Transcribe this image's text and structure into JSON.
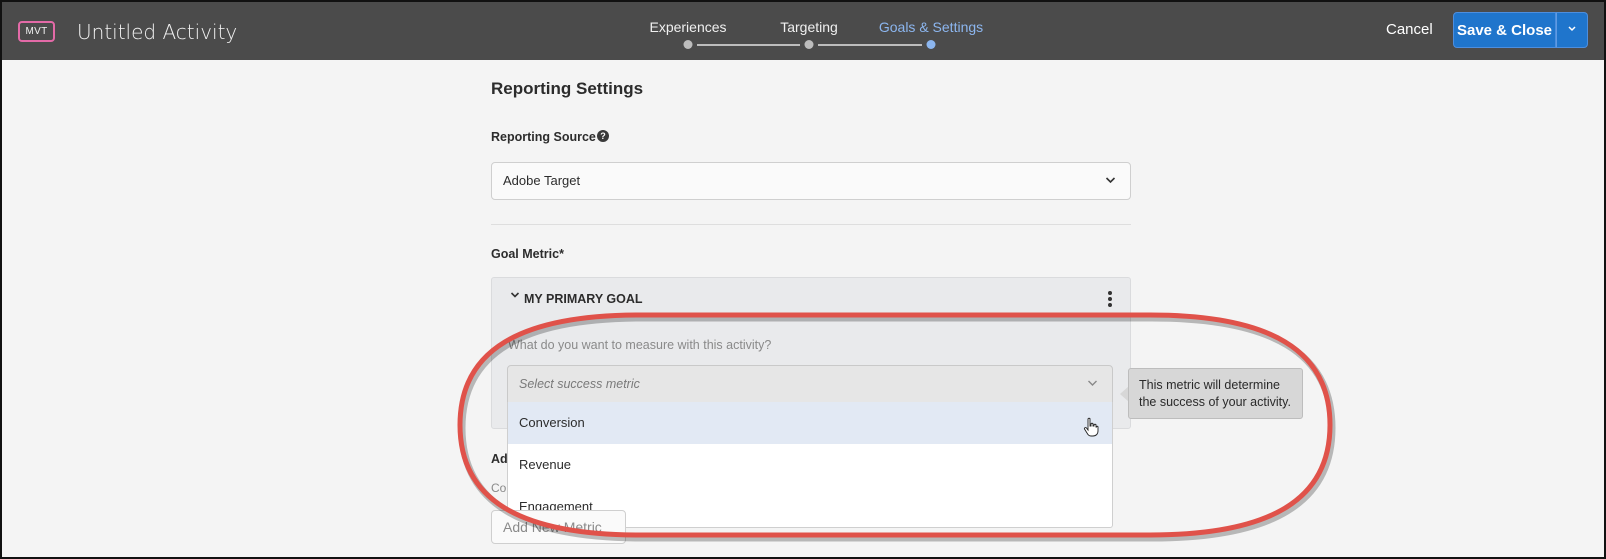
{
  "header": {
    "badge": "MVT",
    "title": "Untitled Activity",
    "steps": [
      {
        "label": "Experiences",
        "active": false
      },
      {
        "label": "Targeting",
        "active": false
      },
      {
        "label": "Goals & Settings",
        "active": true
      }
    ],
    "cancel_label": "Cancel",
    "save_label": "Save & Close",
    "save_dropdown_icon": "chevron-down-icon"
  },
  "reporting": {
    "section_title": "Reporting Settings",
    "source_label": "Reporting Source",
    "source_help_icon": "help-icon",
    "source_value": "Adobe Target"
  },
  "goal": {
    "label": "Goal Metric*",
    "panel_title": "MY PRIMARY GOAL",
    "question": "What do you want to measure with this activity?",
    "metric_placeholder": "Select success metric",
    "options": [
      "Conversion",
      "Revenue",
      "Engagement"
    ],
    "hovered_option": "Conversion",
    "tooltip": "This metric will determine the success of your activity."
  },
  "additional": {
    "label_partial": "Ad",
    "text_partial": "Co",
    "button_partial": "Add New Metric"
  },
  "colors": {
    "topbar": "#4b4b4b",
    "accent_blue": "#1f75cc",
    "active_step": "#8cb6ef",
    "badge_pink": "#e36aa7",
    "highlight_red": "#e0524a"
  }
}
